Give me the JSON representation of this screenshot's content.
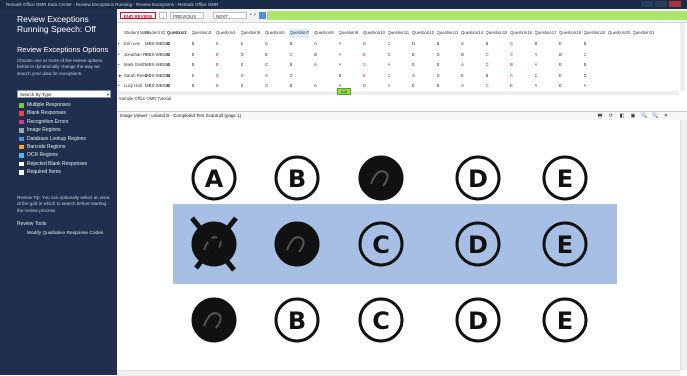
{
  "titlebar": {
    "text": "Remark Office OMR Data Center - Review Exceptions Running - Review Exceptions - Remark Office OMR"
  },
  "sidebar": {
    "title": "Review Exceptions Running Speech: Off",
    "options_heading": "Review Exceptions Options",
    "description": "Choose one or more of the review options below to dynamically change the way we search your data for exceptions.",
    "search_by": "Search By Type",
    "items": [
      {
        "label": "Multiple Responses",
        "color": "#7dc242"
      },
      {
        "label": "Blank Responses",
        "color": "#e8473f"
      },
      {
        "label": "Recognition Errors",
        "color": "#d93a8e"
      },
      {
        "label": "Image Regions",
        "color": "#9aa6b7"
      },
      {
        "label": "Database Lookup Regions",
        "color": "#4a90e2"
      },
      {
        "label": "Barcode Regions",
        "color": "#f5a623"
      },
      {
        "label": "OCR Regions",
        "color": "#4ab8e8"
      },
      {
        "label": "Rejected Blank Responses",
        "color": "#ffffff"
      },
      {
        "label": "Required Items",
        "color": "#ffffff"
      }
    ],
    "tip": "Review Tip: You can optionally select an area of the grid in which to search before starting the review process.",
    "tools_heading": "Review Tools",
    "tool_link": "Modify Qualitative Response Codes"
  },
  "toolbar": {
    "sort_label": "END REVIEW",
    "filter_label": "↓",
    "prev_label": "PREVIOUS",
    "next_label": "NEXT",
    "glyphs": "•   ✓"
  },
  "grid": {
    "headers": [
      "",
      "Student Nam",
      "Student ID",
      "Question1",
      "Question2",
      "Question3",
      "Question4",
      "Question5",
      "Question6",
      "Question7",
      "Question8",
      "Question9",
      "Question10",
      "Question11",
      "Question12",
      "Question13",
      "Question14",
      "Question15",
      "Question16",
      "Question17",
      "Question18",
      "Question19",
      "Question20",
      "Question21"
    ],
    "rows": [
      {
        "marker": "•",
        "cells": [
          "Erin Lee",
          "MBS-WB024",
          "B",
          "C",
          "B",
          "E",
          "E",
          "C",
          "B",
          "A",
          "A",
          "D",
          "C",
          "D",
          "B",
          "A",
          "B",
          "C",
          "B",
          "E",
          "B"
        ]
      },
      {
        "marker": "•",
        "cells": [
          "Jonathan Pr",
          "MBS-WB024",
          "E",
          "C",
          "B",
          "E",
          "D",
          "E",
          "C",
          "B",
          "A",
          "E",
          "C",
          "E",
          "D",
          "B",
          "C",
          "C",
          "A",
          "B",
          "C"
        ]
      },
      {
        "marker": "•",
        "cells": [
          "Mark Smith",
          "MBS-WB024",
          "A",
          "C",
          "B",
          "E",
          "E",
          "C",
          "B",
          "A",
          "A",
          "C",
          "A",
          "E",
          "B",
          "A",
          "C",
          "B",
          "A",
          "E",
          "B"
        ]
      },
      {
        "marker": "►",
        "cells": [
          "Sarah Reed",
          "MBS-WB024",
          "E",
          "D",
          "E",
          "C",
          "D",
          "A",
          "D",
          "",
          "B",
          "E",
          "C",
          "A",
          "D",
          "E",
          "B",
          "A",
          "C",
          "E",
          "D"
        ]
      },
      {
        "marker": "•",
        "cells": [
          "Lucy Hall",
          "MBS-WB024",
          "E",
          "C",
          "B",
          "E",
          "E",
          "C",
          "B",
          "A",
          "A",
          "D",
          "A",
          "E",
          "B",
          "A",
          "C",
          "E",
          "A",
          "E",
          "A"
        ]
      }
    ],
    "current_answer": "A,B",
    "footer": "Sample Office OMR Tutorial"
  },
  "viewer": {
    "title": "Image Viewer - Leland B - Completed Test Scantroll (page 1)",
    "tools": [
      "🖶",
      "⟳",
      "◧",
      "▣",
      "🔍",
      "🔍",
      "✕"
    ],
    "letters": [
      "A",
      "B",
      "C",
      "D",
      "E"
    ],
    "rows": [
      {
        "filled": [
          false,
          false,
          true,
          false,
          false
        ],
        "crossed": [
          false,
          false,
          false,
          false,
          false
        ],
        "highlight": false
      },
      {
        "filled": [
          true,
          true,
          false,
          false,
          false
        ],
        "crossed": [
          true,
          false,
          false,
          false,
          false
        ],
        "highlight": true
      },
      {
        "filled": [
          true,
          false,
          false,
          false,
          false
        ],
        "crossed": [
          false,
          false,
          false,
          false,
          false
        ],
        "highlight": false
      }
    ],
    "highlight_color": "#a7bfe4"
  }
}
